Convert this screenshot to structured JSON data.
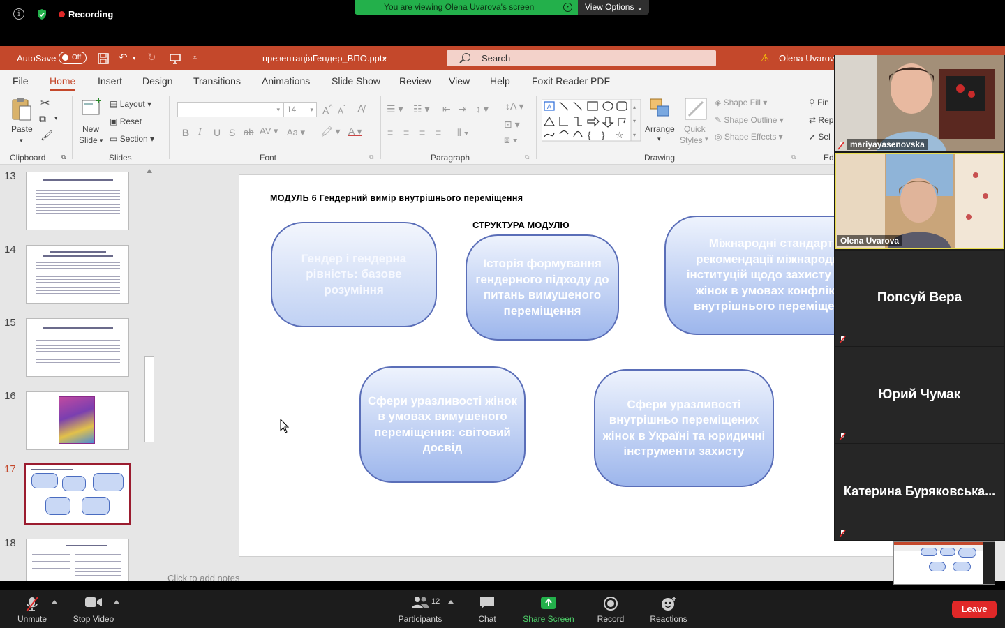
{
  "zoom_top": {
    "recording": "Recording",
    "viewing": "You are viewing Olena Uvarova's screen",
    "view_options": "View Options"
  },
  "ppt": {
    "autosave": "AutoSave",
    "autosave_state": "Off",
    "filename": "презентаціяГендер_ВПО.pptx",
    "search_placeholder": "Search",
    "user": "Olena Uvarova",
    "tabs": [
      "File",
      "Home",
      "Insert",
      "Design",
      "Transitions",
      "Animations",
      "Slide Show",
      "Review",
      "View",
      "Help",
      "Foxit Reader PDF"
    ],
    "active_tab": "Home",
    "ribbon": {
      "paste": "Paste",
      "clipboard": "Clipboard",
      "new_slide_1": "New",
      "new_slide_2": "Slide",
      "layout": "Layout",
      "reset": "Reset",
      "section": "Section",
      "slides": "Slides",
      "font_size": "14",
      "font": "Font",
      "paragraph": "Paragraph",
      "arrange": "Arrange",
      "quick_styles_1": "Quick",
      "quick_styles_2": "Styles",
      "shape_fill": "Shape Fill",
      "shape_outline": "Shape Outline",
      "shape_effects": "Shape Effects",
      "drawing": "Drawing",
      "find": "Fin",
      "replace": "Rep",
      "select": "Sel",
      "editing": "Ed"
    },
    "thumbnails": [
      {
        "num": "13"
      },
      {
        "num": "14"
      },
      {
        "num": "15"
      },
      {
        "num": "16"
      },
      {
        "num": "17"
      },
      {
        "num": "18"
      }
    ],
    "selected_slide": "17",
    "slide": {
      "title": "МОДУЛЬ 6 Гендерний вимір внутрішнього  переміщення",
      "subtitle": "СТРУКТУРА МОДУЛЮ",
      "boxes": [
        "Гендер і гендерна рівність: базове розуміння",
        "Історія формування гендерного підходу до питань вимушеного переміщення",
        "Міжнародні стандарти рекомендації міжнародних інституцій щодо захисту прав жінок в умовах конфлікту і внутрішнього переміщення",
        "Сфери уразливості жінок в умовах вимушеного переміщення: світовий досвід",
        "Сфери уразливості внутрішньо переміщених жінок в Україні та юридичні інструменти захисту"
      ]
    },
    "notes_placeholder": "Click to add notes"
  },
  "gallery": [
    {
      "name": "mariyayasenovska",
      "video": true
    },
    {
      "name": "Olena Uvarova",
      "video": true,
      "active": true
    },
    {
      "name": "Попсуй Вера",
      "video": false
    },
    {
      "name": "Юрий Чумак",
      "video": false
    },
    {
      "name": "Катерина Буряковська...",
      "video": false
    }
  ],
  "zoom_bottom": {
    "unmute": "Unmute",
    "stop_video": "Stop Video",
    "participants": "Participants",
    "participants_count": "12",
    "chat": "Chat",
    "share_screen": "Share Screen",
    "record": "Record",
    "reactions": "Reactions",
    "leave": "Leave"
  },
  "colors": {
    "ppt_accent": "#c4482b",
    "viewing_green": "#23b04b",
    "leave_red": "#e02828",
    "share_green": "#23b04b"
  }
}
